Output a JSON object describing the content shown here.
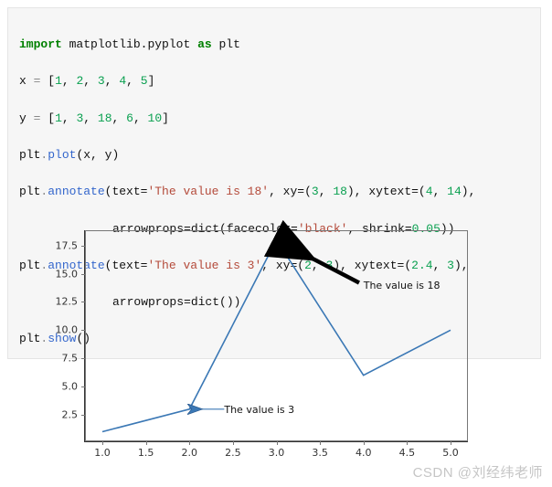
{
  "code": {
    "l1_import": "import",
    "l1_mod": "matplotlib.pyplot",
    "l1_as": "as",
    "l1_alias": "plt",
    "l2_var": "x",
    "l2_list": "[1, 2, 3, 4, 5]",
    "l3_var": "y",
    "l3_list": "[1, 3, 18, 6, 10]",
    "l4_obj": "plt",
    "l4_fn": "plot",
    "l4_args": "(x, y)",
    "l5_obj": "plt",
    "l5_fn": "annotate",
    "l5a": "(text=",
    "l5s1": "'The value is 18'",
    "l5b": ", xy=(",
    "l5n1": "3",
    "l5b2": ", ",
    "l5n2": "18",
    "l5c": "), xytext=(",
    "l5n3": "4",
    "l5c2": ", ",
    "l5n4": "14",
    "l5d": "),",
    "l6a": "arrowprops=dict(facecolor=",
    "l6s": "'black'",
    "l6b": ", shrink=",
    "l6n": "0.05",
    "l6c": "))",
    "l7_obj": "plt",
    "l7_fn": "annotate",
    "l7a": "(text=",
    "l7s1": "'The value is 3'",
    "l7b": ", xy=(",
    "l7n1": "2",
    "l7b2": ", ",
    "l7n2": "3",
    "l7c": "), xytext=(",
    "l7n3": "2.4",
    "l7c2": ", ",
    "l7n4": "3",
    "l7d": "),",
    "l8a": "arrowprops=dict())",
    "l9_obj": "plt",
    "l9_fn": "show",
    "l9_args": "()"
  },
  "chart_data": {
    "type": "line",
    "x": [
      1,
      2,
      3,
      4,
      5
    ],
    "y": [
      1,
      3,
      18,
      6,
      10
    ],
    "xlim": [
      0.8,
      5.2
    ],
    "ylim": [
      0.15,
      18.85
    ],
    "xticks": [
      "1.0",
      "1.5",
      "2.0",
      "2.5",
      "3.0",
      "3.5",
      "4.0",
      "4.5",
      "5.0"
    ],
    "xtick_vals": [
      1.0,
      1.5,
      2.0,
      2.5,
      3.0,
      3.5,
      4.0,
      4.5,
      5.0
    ],
    "yticks": [
      "2.5",
      "5.0",
      "7.5",
      "10.0",
      "12.5",
      "15.0",
      "17.5"
    ],
    "ytick_vals": [
      2.5,
      5.0,
      7.5,
      10.0,
      12.5,
      15.0,
      17.5
    ],
    "annotations": [
      {
        "text": "The value is 18",
        "xy": [
          3,
          18
        ],
        "xytext": [
          4,
          14
        ],
        "style": "thick"
      },
      {
        "text": "The value is 3",
        "xy": [
          2,
          3
        ],
        "xytext": [
          2.4,
          3
        ],
        "style": "thin"
      }
    ],
    "line_color": "#3b78b5"
  },
  "watermark": "CSDN @刘经纬老师"
}
